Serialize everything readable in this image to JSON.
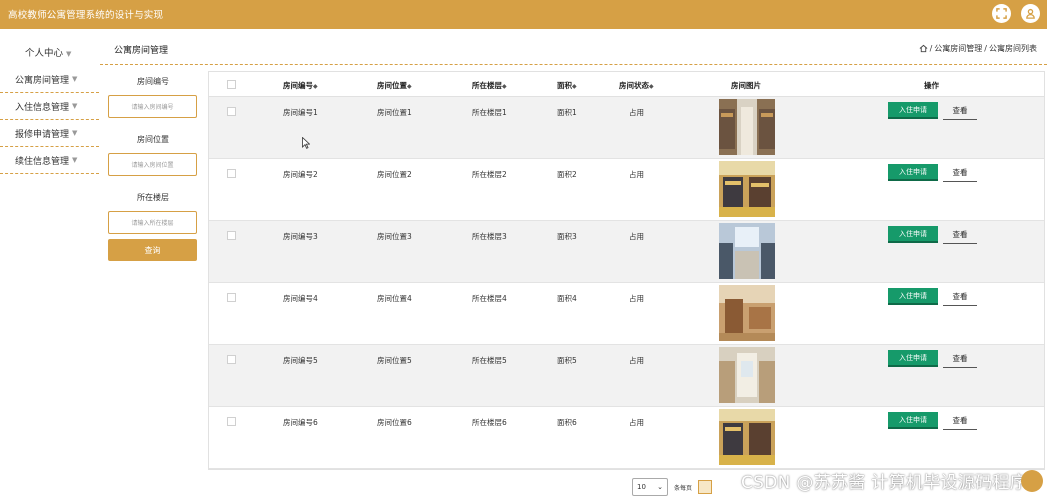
{
  "header": {
    "app_title": "高校教师公寓管理系统的设计与实现",
    "icons": [
      "fullscreen-icon",
      "user-icon"
    ],
    "accent_color": "#d6a045"
  },
  "nav": {
    "user_center": "个人中心",
    "section_title": "公寓房间管理",
    "breadcrumb": [
      "公寓房间管理",
      "公寓房间列表"
    ]
  },
  "sidebar": {
    "items": [
      {
        "label": "公寓房间管理"
      },
      {
        "label": "入住信息管理"
      },
      {
        "label": "报修申请管理"
      },
      {
        "label": "续住信息管理"
      }
    ]
  },
  "filter": {
    "room_no_label": "房间编号",
    "room_no_placeholder": "请输入房间编号",
    "location_label": "房间位置",
    "location_placeholder": "请输入房间位置",
    "floor_label": "所在楼层",
    "floor_placeholder": "请输入所在楼层",
    "query_label": "查询"
  },
  "table": {
    "headers": {
      "room_no": "房间编号",
      "location": "房间位置",
      "floor": "所在楼层",
      "area": "面积",
      "status": "房间状态",
      "photo": "房间图片",
      "actions": "操作"
    },
    "apply_label": "入住申请",
    "view_label": "查看",
    "rows": [
      {
        "room_no": "房间编号1",
        "location": "房间位置1",
        "floor": "所在楼层1",
        "area": "面积1",
        "status": "占用"
      },
      {
        "room_no": "房间编号2",
        "location": "房间位置2",
        "floor": "所在楼层2",
        "area": "面积2",
        "status": "占用"
      },
      {
        "room_no": "房间编号3",
        "location": "房间位置3",
        "floor": "所在楼层3",
        "area": "面积3",
        "status": "占用"
      },
      {
        "room_no": "房间编号4",
        "location": "房间位置4",
        "floor": "所在楼层4",
        "area": "面积4",
        "status": "占用"
      },
      {
        "room_no": "房间编号5",
        "location": "房间位置5",
        "floor": "所在楼层5",
        "area": "面积5",
        "status": "占用"
      },
      {
        "room_no": "房间编号6",
        "location": "房间位置6",
        "floor": "所在楼层6",
        "area": "面积6",
        "status": "占用"
      }
    ]
  },
  "pagination": {
    "page_size": "10",
    "per_page_label": "条每页"
  },
  "watermark": "CSDN @苏苏酱    计算机毕设源码程序"
}
